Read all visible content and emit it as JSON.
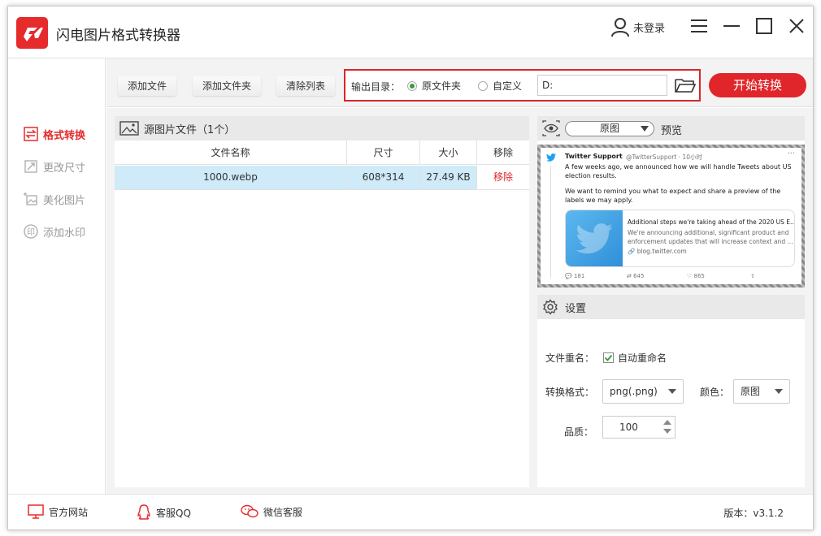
{
  "app": {
    "title": "闪电图片格式转换器",
    "user_label": "未登录",
    "brand_color": "#e0262b"
  },
  "sidebar": {
    "items": [
      {
        "label": "格式转换",
        "icon": "swap-icon",
        "active": true
      },
      {
        "label": "更改尺寸",
        "icon": "resize-icon",
        "active": false
      },
      {
        "label": "美化图片",
        "icon": "beautify-icon",
        "active": false
      },
      {
        "label": "添加水印",
        "icon": "watermark-icon",
        "active": false
      }
    ]
  },
  "toolbar": {
    "add_file": "添加文件",
    "add_folder": "添加文件夹",
    "clear_list": "清除列表",
    "output_label": "输出目录：",
    "radio_original": "原文件夹",
    "radio_custom": "自定义",
    "selected_output": "原文件夹",
    "path_value": "D:",
    "start_button": "开始转换"
  },
  "file_panel": {
    "title": "源图片文件（1个）",
    "columns": [
      "文件名称",
      "尺寸",
      "大小",
      "移除"
    ],
    "rows": [
      {
        "name": "1000.webp",
        "size": "608*314",
        "filesize": "27.49 KB",
        "action": "移除"
      }
    ]
  },
  "preview": {
    "select_value": "原图",
    "title": "预览",
    "tweet": {
      "name": "Twitter Support",
      "handle": "@TwitterSupport · 10小时",
      "text1": "A few weeks ago, we announced how we will handle Tweets about US election results.",
      "text2": "We want to remind you what to expect and share a preview of the labels we may apply.",
      "card_title": "Additional steps we're taking ahead of the 2020 US E...",
      "card_desc": "We're announcing additional, significant product and enforcement updates that will increase context and ...",
      "card_link": "blog.twitter.com",
      "replies": "181",
      "retweets": "645",
      "likes": "865"
    }
  },
  "settings": {
    "title": "设置",
    "rename_label": "文件重名：",
    "auto_rename": "自动重命名",
    "auto_rename_checked": true,
    "format_label": "转换格式：",
    "format_value": "png(.png)",
    "color_label": "颜色：",
    "color_value": "原图",
    "quality_label": "品质：",
    "quality_value": "100"
  },
  "footer": {
    "website": "官方网站",
    "qq": "客服QQ",
    "wechat": "微信客服",
    "version": "版本：v3.1.2"
  }
}
